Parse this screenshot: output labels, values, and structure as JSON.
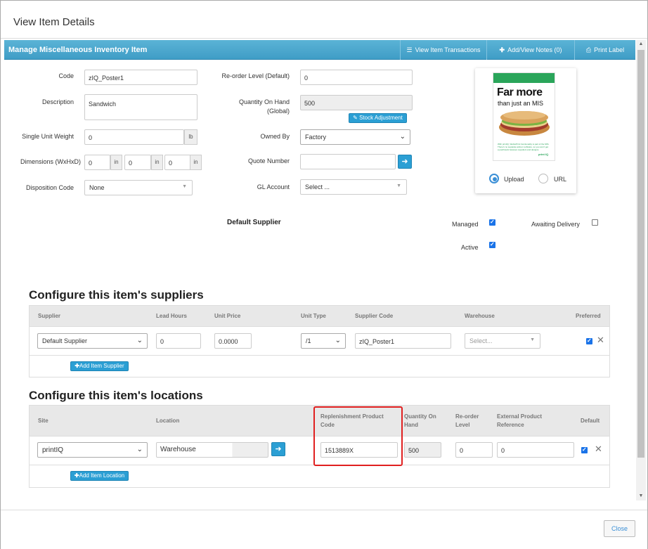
{
  "modal": {
    "title": "View Item Details",
    "close_label": "Close"
  },
  "header": {
    "title": "Manage Miscellaneous Inventory Item",
    "buttons": [
      {
        "icon": "list-icon",
        "label": "View Item Transactions"
      },
      {
        "icon": "plus-icon",
        "label": "Add/View Notes (0)"
      },
      {
        "icon": "print-icon",
        "label": "Print Label"
      }
    ]
  },
  "form": {
    "code_label": "Code",
    "code_value": "zIQ_Poster1",
    "description_label": "Description",
    "description_value": "Sandwich",
    "weight_label": "Single Unit Weight",
    "weight_value": "0",
    "weight_unit": "lb",
    "dimensions_label": "Dimensions (WxHxD)",
    "dim_w": "0",
    "dim_h": "0",
    "dim_d": "0",
    "dim_unit": "in",
    "disposition_label": "Disposition Code",
    "disposition_value": "None",
    "reorder_label": "Re-order Level (Default)",
    "reorder_value": "0",
    "qoh_label_1": "Quantity On Hand",
    "qoh_label_2": "(Global)",
    "qoh_value": "500",
    "stock_adjustment_label": "Stock Adjustment",
    "owned_by_label": "Owned By",
    "owned_by_value": "Factory",
    "quote_number_label": "Quote Number",
    "quote_number_value": "",
    "gl_account_label": "GL Account",
    "gl_account_value": "Select ...",
    "default_supplier_label": "Default Supplier",
    "managed_label": "Managed",
    "managed_checked": true,
    "awaiting_delivery_label": "Awaiting Delivery",
    "awaiting_checked": false,
    "active_label": "Active",
    "active_checked": true
  },
  "image": {
    "poster_headline": "Far more",
    "poster_subline": "than just an MIS",
    "poster_fine_print": "With printIQ, WebtoPrint functionality is part of the MIS. There's no separate add-on software, so you won't get a patchwork between suppliers and designs.",
    "poster_logo": "print IQ",
    "upload_label": "Upload",
    "url_label": "URL",
    "selected": "Upload"
  },
  "suppliers": {
    "title": "Configure this item's suppliers",
    "columns": [
      "Supplier",
      "Lead Hours",
      "Unit Price",
      "Unit Type",
      "Supplier Code",
      "Warehouse",
      "Preferred"
    ],
    "row": {
      "supplier": "Default Supplier",
      "lead_hours": "0",
      "unit_price": "0.0000",
      "unit_type": "/1",
      "supplier_code": "zIQ_Poster1",
      "warehouse": "Select...",
      "preferred": true
    },
    "add_label": "Add Item Supplier"
  },
  "locations": {
    "title": "Configure this item's locations",
    "columns": {
      "site": "Site",
      "location": "Location",
      "replenishment_1": "Replenishment Product",
      "replenishment_2": "Code",
      "qoh_1": "Quantity On",
      "qoh_2": "Hand",
      "reorder_1": "Re-order",
      "reorder_2": "Level",
      "ext_ref_1": "External Product",
      "ext_ref_2": "Reference",
      "default": "Default"
    },
    "row": {
      "site": "printIQ",
      "location": "Warehouse",
      "replenishment_code": "1513889X",
      "qoh": "500",
      "reorder": "0",
      "ext_ref": "0",
      "default": true
    },
    "add_label": "Add Item Location"
  },
  "accent_color": "#2b9fd4",
  "highlight_color": "#e02020"
}
